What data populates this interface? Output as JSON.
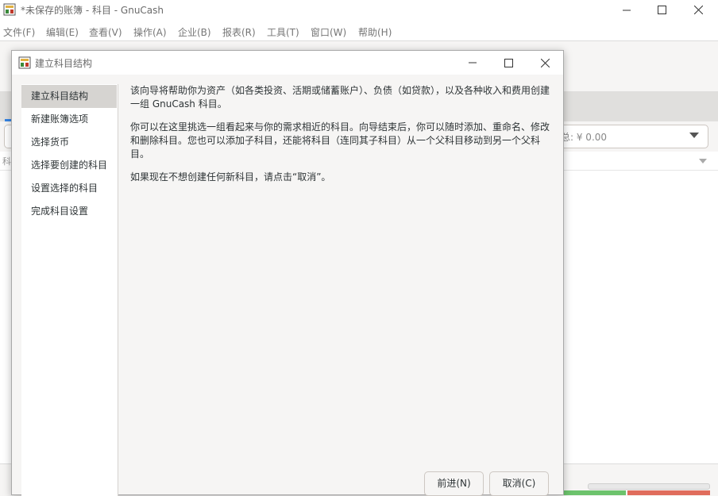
{
  "main_window": {
    "title": "*未保存的账簿 - 科目 - GnuCash",
    "menu": [
      "文件(F)",
      "编辑(E)",
      "查看(V)",
      "操作(A)",
      "企业(B)",
      "报表(R)",
      "工具(T)",
      "窗口(W)",
      "帮助(H)"
    ],
    "background_total": "总: ¥ 0.00",
    "background_column": "科"
  },
  "dialog": {
    "title": "建立科目结构",
    "steps": [
      "建立科目结构",
      "新建账簿选项",
      "选择货币",
      "选择要创建的科目",
      "设置选择的科目",
      "完成科目设置"
    ],
    "active_step": 0,
    "paragraphs": [
      "该向导将帮助你为资产（如各类投资、活期或储蓄账户）、负债（如贷款），以及各种收入和费用创建一组 GnuCash 科目。",
      "你可以在这里挑选一组看起来与你的需求相近的科目。向导结束后，你可以随时添加、重命名、修改和删除科目。您也可以添加子科目，还能将科目（连同其子科目）从一个父科目移动到另一个父科目。",
      "如果现在不想创建任何新科目，请点击“取消”。"
    ],
    "buttons": {
      "next": "前进(N)",
      "cancel": "取消(C)"
    }
  },
  "icons": {
    "app": "gnucash-app-icon",
    "minimize": "minimize-icon",
    "maximize": "maximize-icon",
    "close": "close-icon"
  },
  "colors": {
    "active_step_bg": "#d6d4d1",
    "dialog_bg": "#f6f5f4",
    "accent": "#3584e4"
  }
}
